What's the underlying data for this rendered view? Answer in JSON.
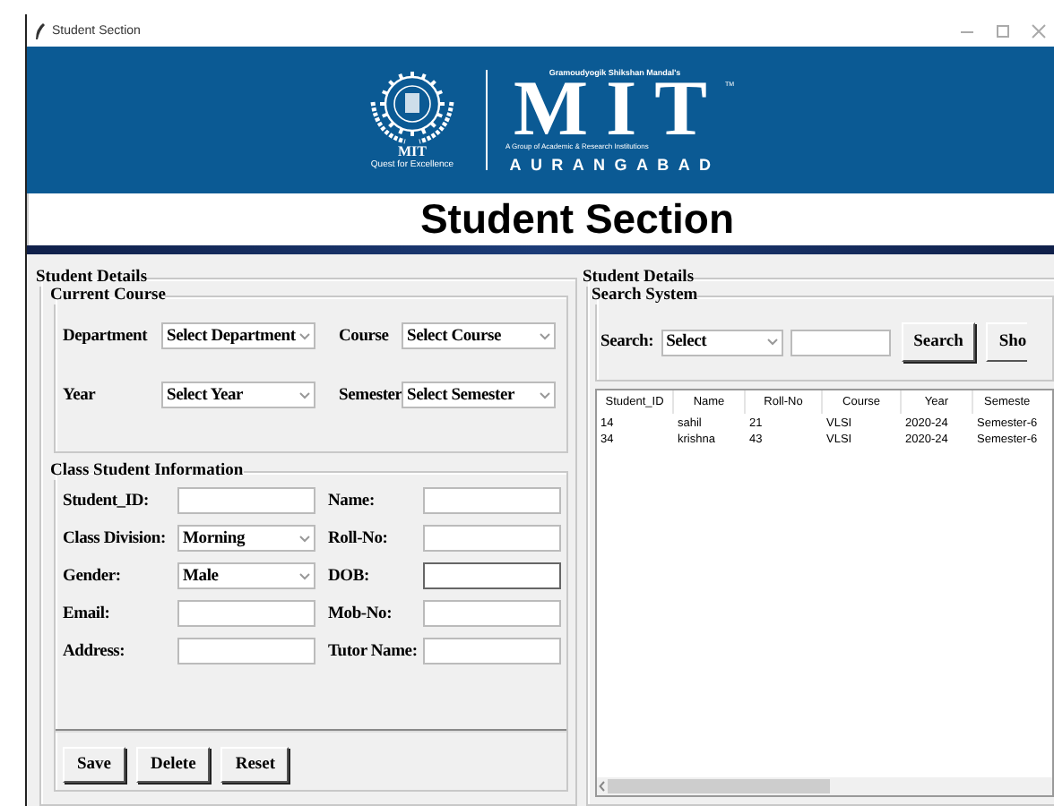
{
  "window": {
    "title": "Student Section"
  },
  "banner": {
    "emblem_caption": "MIT",
    "emblem_tagline": "Quest for Excellence",
    "society": "Gramoudyogik Shikshan Mandal's",
    "logo": "MIT",
    "trademark": "TM",
    "subtitle": "A Group of Academic & Research Institutions",
    "city": "AURANGABAD"
  },
  "heading": "Student Section",
  "left_panel": {
    "title": "Student Details",
    "current_course": {
      "title": "Current Course",
      "fields": [
        {
          "label": "Department",
          "value": "Select Department"
        },
        {
          "label": "Course",
          "value": "Select Course"
        },
        {
          "label": "Year",
          "value": "Select Year"
        },
        {
          "label": "Semester",
          "value": "Select Semester"
        }
      ]
    },
    "class_info": {
      "title": "Class Student Information",
      "fields": [
        {
          "label": "Student_ID:",
          "kind": "entry",
          "focused": false
        },
        {
          "label": "Name:",
          "kind": "entry",
          "focused": false
        },
        {
          "label": "Class Division:",
          "kind": "combo",
          "value": "Morning"
        },
        {
          "label": "Roll-No:",
          "kind": "entry",
          "focused": false
        },
        {
          "label": "Gender:",
          "kind": "combo",
          "value": "Male"
        },
        {
          "label": "DOB:",
          "kind": "entry",
          "focused": true
        },
        {
          "label": "Email:",
          "kind": "entry",
          "focused": false
        },
        {
          "label": "Mob-No:",
          "kind": "entry",
          "focused": false
        },
        {
          "label": "Address:",
          "kind": "entry",
          "focused": false
        },
        {
          "label": "Tutor Name:",
          "kind": "entry",
          "focused": false
        }
      ]
    },
    "buttons": [
      "Save",
      "Delete",
      "Reset"
    ]
  },
  "right_panel": {
    "title": "Student Details",
    "search": {
      "title": "Search System",
      "label": "Search:",
      "combo_value": "Select",
      "buttons": [
        "Search",
        "Sho"
      ]
    },
    "table": {
      "columns": [
        "Student_ID",
        "Name",
        "Roll-No",
        "Course",
        "Year",
        "Semeste"
      ],
      "rows": [
        [
          "14",
          "sahil",
          "21",
          "VLSI",
          "2020-24",
          "Semester-6"
        ],
        [
          "34",
          "krishna",
          "43",
          "VLSI",
          "2020-24",
          "Semester-6"
        ]
      ]
    }
  }
}
